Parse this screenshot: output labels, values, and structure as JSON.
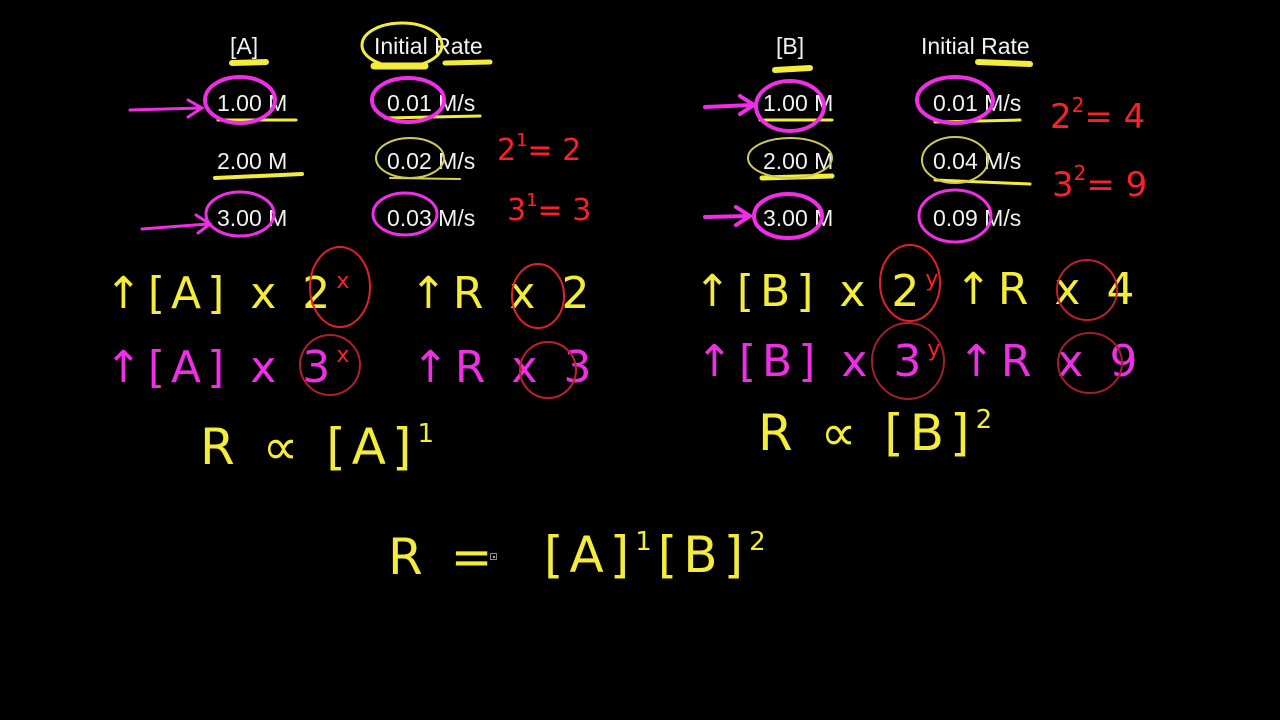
{
  "table_a": {
    "col1_header": "[A]",
    "col2_header": "Initial Rate",
    "rows": [
      {
        "conc": "1.00 M",
        "rate": "0.01 M/s"
      },
      {
        "conc": "2.00 M",
        "rate": "0.02 M/s"
      },
      {
        "conc": "3.00 M",
        "rate": "0.03 M/s"
      }
    ],
    "annotations": [
      {
        "base": "2",
        "exp": "1",
        "result": "= 2"
      },
      {
        "base": "3",
        "exp": "1",
        "result": "= 3"
      }
    ]
  },
  "table_b": {
    "col1_header": "[B]",
    "col2_header": "Initial Rate",
    "rows": [
      {
        "conc": "1.00 M",
        "rate": "0.01 M/s"
      },
      {
        "conc": "2.00 M",
        "rate": "0.04 M/s"
      },
      {
        "conc": "3.00 M",
        "rate": "0.09 M/s"
      }
    ],
    "annotations": [
      {
        "base": "2",
        "exp": "2",
        "result": "= 4"
      },
      {
        "base": "3",
        "exp": "2",
        "result": "= 9"
      }
    ]
  },
  "work_a": {
    "line1_left": "↑[A] x 2",
    "line1_left_exp": "x",
    "line1_right": "↑R x 2",
    "line2_left": "↑[A] x 3",
    "line2_left_exp": "x",
    "line2_right": "↑R x 3",
    "conclusion": "R ∝ [A]",
    "conclusion_exp": "1"
  },
  "work_b": {
    "line1_left": "↑[B] x 2",
    "line1_left_exp": "y",
    "line1_right": "↑R x 4",
    "line2_left": "↑[B] x 3",
    "line2_left_exp": "y",
    "line2_right": "↑R x 9",
    "conclusion": "R ∝ [B]",
    "conclusion_exp": "2"
  },
  "rate_law": {
    "lhs": "R =",
    "term_a": "[A]",
    "term_a_exp": "1",
    "term_b": "[B]",
    "term_b_exp": "2"
  },
  "colors": {
    "background": "#000000",
    "yellow_ink": "#f3ec3a",
    "magenta_ink": "#ef2ee6",
    "red_ink": "#ff1f2a",
    "table_text": "#f2f2f2"
  }
}
